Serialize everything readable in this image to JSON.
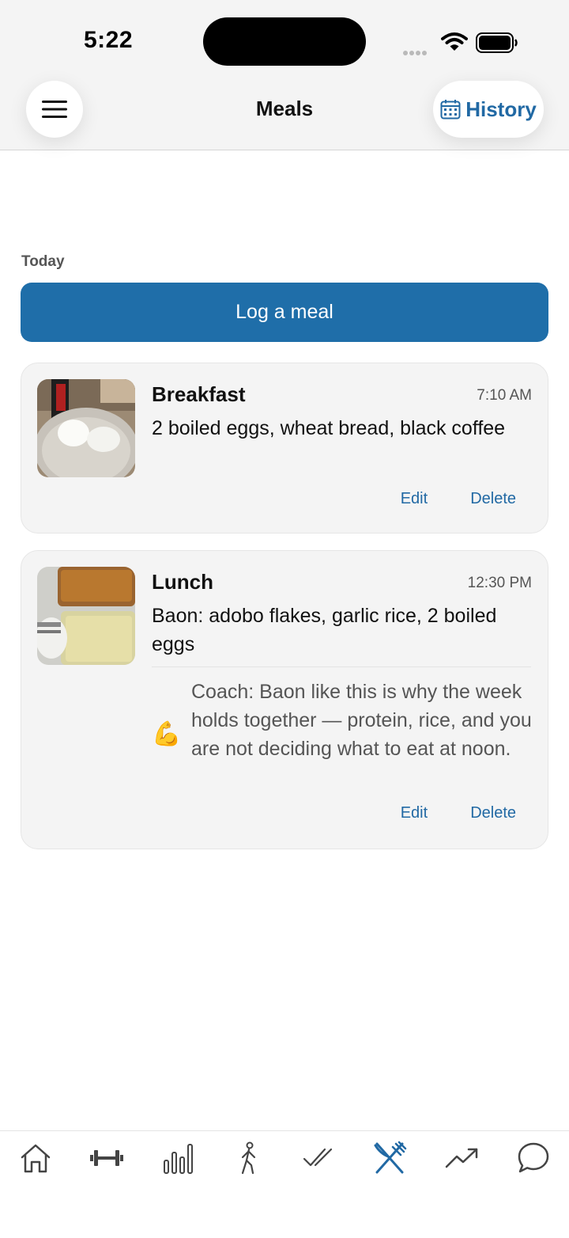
{
  "status_bar": {
    "time": "5:22"
  },
  "header": {
    "title": "Meals",
    "history_label": "History"
  },
  "main": {
    "section_label": "Today",
    "log_button_label": "Log a meal",
    "meals": [
      {
        "name": "Breakfast",
        "time": "7:10 AM",
        "description": "2 boiled eggs, wheat bread, black coffee",
        "edit_label": "Edit",
        "delete_label": "Delete"
      },
      {
        "name": "Lunch",
        "time": "12:30 PM",
        "description": "Baon: adobo flakes, garlic rice, 2 boiled eggs",
        "coach_emoji": "💪",
        "coach_text": "Coach: Baon like this is why the week holds together — protein, rice, and you are not deciding what to eat at noon.",
        "edit_label": "Edit",
        "delete_label": "Delete"
      }
    ]
  },
  "tab_bar": {
    "active_tab": "meals",
    "tabs": [
      {
        "id": "home",
        "icon": "home-icon"
      },
      {
        "id": "workouts",
        "icon": "dumbbell-icon"
      },
      {
        "id": "stats",
        "icon": "bar-chart-icon"
      },
      {
        "id": "walk",
        "icon": "walking-icon"
      },
      {
        "id": "checks",
        "icon": "double-check-icon"
      },
      {
        "id": "meals",
        "icon": "fork-knife-icon"
      },
      {
        "id": "progress",
        "icon": "trend-up-icon"
      },
      {
        "id": "chat",
        "icon": "chat-bubble-icon"
      }
    ]
  },
  "colors": {
    "accent": "#1f6ea9",
    "link": "#2169a4",
    "card_bg": "#f4f4f4",
    "icon_inactive": "#444444"
  }
}
